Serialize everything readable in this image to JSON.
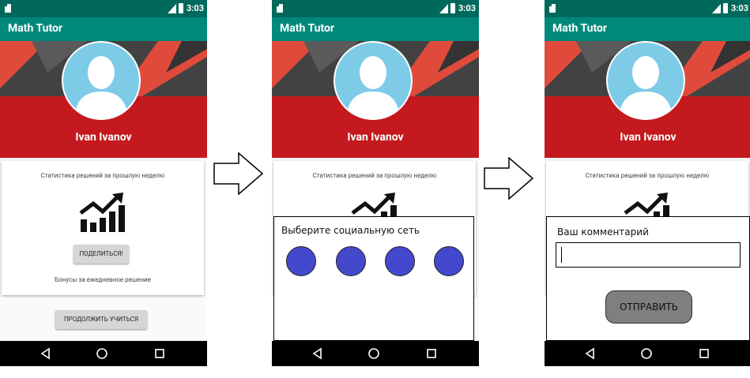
{
  "status_bar": {
    "time": "3:03"
  },
  "app": {
    "title": "Math Tutor"
  },
  "profile": {
    "name": "Ivan Ivanov"
  },
  "stats_card": {
    "stats_label": "Статистика решений за прошлую неделю",
    "share_button": "ПОДЕЛИТЬСЯ!",
    "bonus_label": "Бонусы за ежедневное решение"
  },
  "continue_button": "ПРОДОЛЖИТЬ УЧИТЬСЯ",
  "social_dialog": {
    "title": "Выберите социальную сеть",
    "networks": [
      {
        "icon": "social-network-circle"
      },
      {
        "icon": "social-network-circle"
      },
      {
        "icon": "social-network-circle"
      },
      {
        "icon": "social-network-circle"
      }
    ]
  },
  "comment_dialog": {
    "title": "Ваш комментарий",
    "value": "",
    "send_button": "ОТПРАВИТЬ"
  },
  "colors": {
    "status_bar": "#00695c",
    "toolbar": "#00897b",
    "header_red": "#c4191e",
    "avatar_blue": "#7ecbe8",
    "social_circle": "#4448cc",
    "send_button": "#7f7f7f"
  }
}
